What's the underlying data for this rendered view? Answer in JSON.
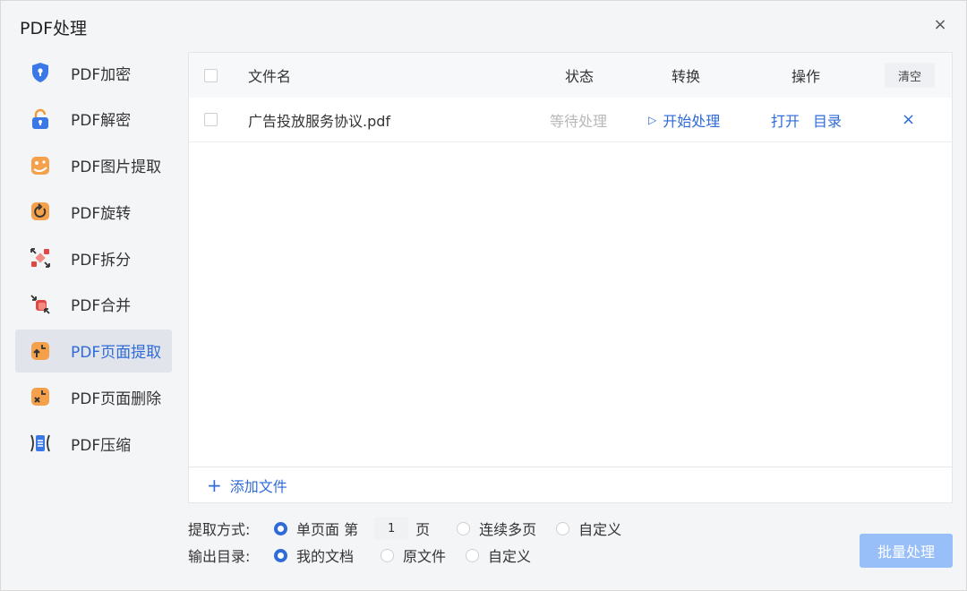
{
  "window": {
    "title": "PDF处理",
    "close": "×"
  },
  "sidebar": {
    "items": [
      {
        "label": "PDF加密"
      },
      {
        "label": "PDF解密"
      },
      {
        "label": "PDF图片提取"
      },
      {
        "label": "PDF旋转"
      },
      {
        "label": "PDF拆分"
      },
      {
        "label": "PDF合并"
      },
      {
        "label": "PDF页面提取"
      },
      {
        "label": "PDF页面删除"
      },
      {
        "label": "PDF压缩"
      }
    ],
    "active_index": 6
  },
  "table": {
    "headers": {
      "name": "文件名",
      "status": "状态",
      "convert": "转换",
      "action": "操作",
      "clear": "清空"
    },
    "rows": [
      {
        "name": "广告投放服务协议.pdf",
        "status": "等待处理",
        "convert": "开始处理",
        "open": "打开",
        "dir": "目录",
        "remove": "×"
      }
    ],
    "add_file": "添加文件"
  },
  "options": {
    "extract_label": "提取方式:",
    "extract": {
      "single_prefix": "单页面 第",
      "page": "1",
      "single_suffix": "页",
      "multi": "连续多页",
      "custom": "自定义"
    },
    "output_label": "输出目录:",
    "output": {
      "mydocs": "我的文档",
      "source": "原文件",
      "custom": "自定义"
    }
  },
  "batch_button": "批量处理",
  "colors": {
    "accent": "#2f6bd8",
    "batch_disabled": "#98bff7"
  }
}
